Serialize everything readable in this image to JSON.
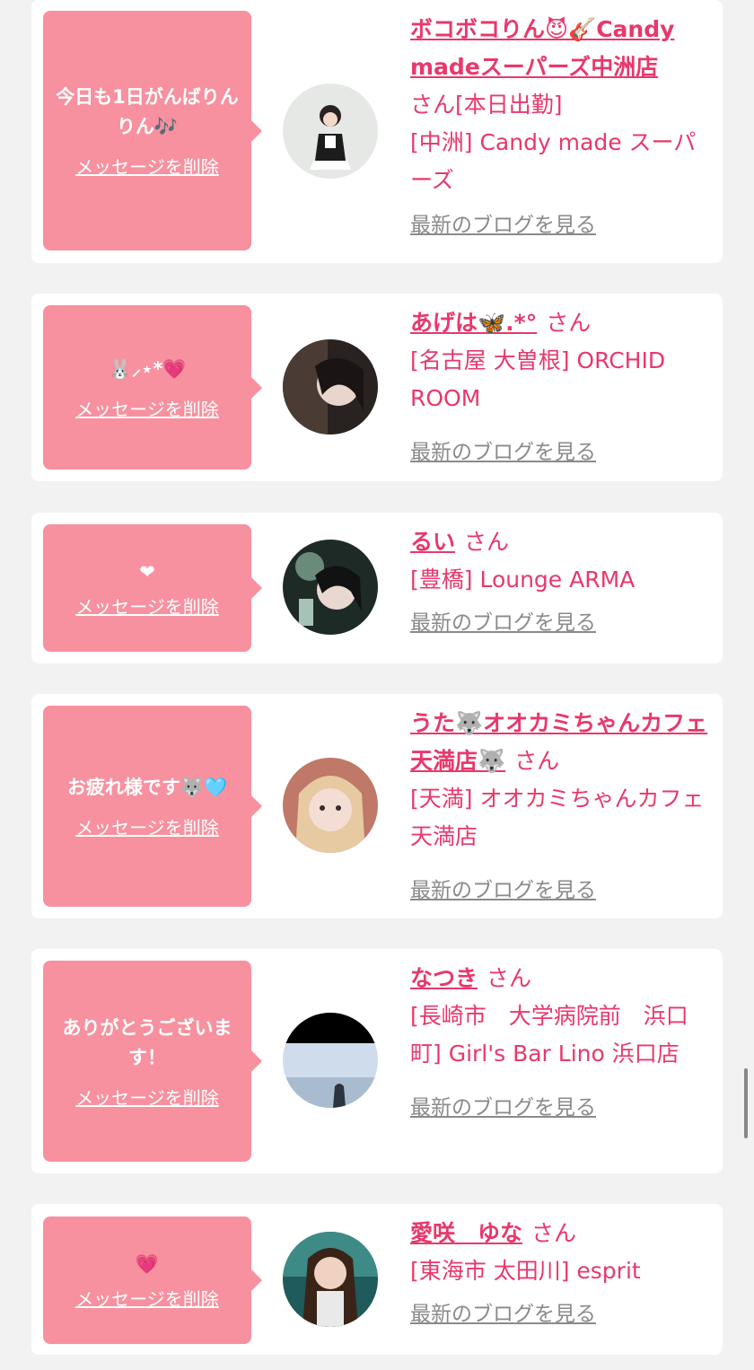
{
  "delete_label": "メッセージを削除",
  "blog_label": "最新のブログを見る",
  "san_label": "さん",
  "colors": {
    "accent": "#e8386b",
    "bubble": "#f7919f",
    "background": "#f2f2f2"
  },
  "cards": [
    {
      "message": "今日も1日がんばりんりん🎶",
      "name": "ボコボコりん😈🎸Candy madeスーパーズ中洲店",
      "status": "[本日出勤]",
      "shop": "[中洲] Candy made スーパーズ",
      "avatar_icon": "person-avatar"
    },
    {
      "message": "🐰⸝⋆*💗",
      "name": "あげは🦋.*°",
      "status": "",
      "shop": "[名古屋 大曽根] ORCHID ROOM",
      "avatar_icon": "person-avatar"
    },
    {
      "message": "❤",
      "name": "るい",
      "status": "",
      "shop": "[豊橋] Lounge ARMA",
      "avatar_icon": "person-avatar"
    },
    {
      "message": "お疲れ様です🐺🩵",
      "name": "うた🐺オオカミちゃんカフェ天満店🐺",
      "status": "",
      "shop": "[天満] オオカミちゃんカフェ天満店",
      "avatar_icon": "person-avatar"
    },
    {
      "message": "ありがとうございます！",
      "name": "なつき",
      "status": "",
      "shop": "[長崎市　大学病院前　浜口町] Girl's Bar Lino 浜口店",
      "avatar_icon": "landscape-avatar"
    },
    {
      "message": "💗",
      "name": "愛咲　ゆな",
      "status": "",
      "shop": "[東海市 太田川] esprit",
      "avatar_icon": "person-avatar"
    }
  ]
}
